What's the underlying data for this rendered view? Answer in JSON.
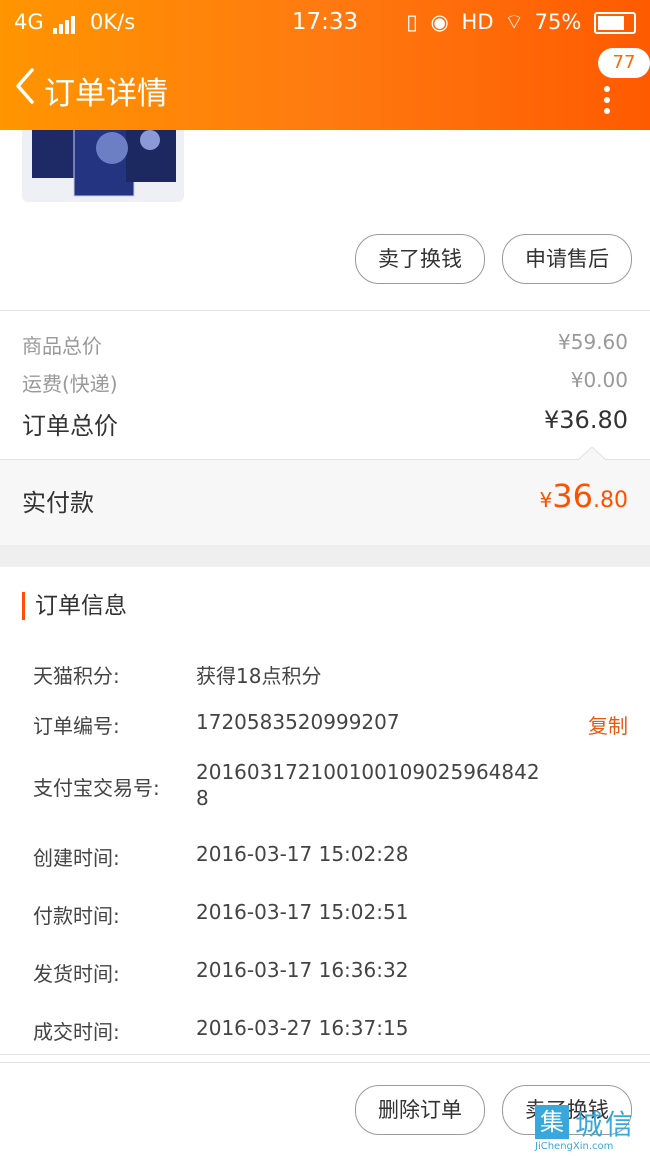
{
  "statusbar": {
    "network": "4G",
    "speed": "0K/s",
    "time": "17:33",
    "hd": "HD",
    "battery": "75%"
  },
  "header": {
    "title": "订单详情",
    "badge": "77"
  },
  "product_actions": {
    "sell_label": "卖了换钱",
    "after_sale_label": "申请售后"
  },
  "price": {
    "goods_total_label": "商品总价",
    "goods_total_value": "¥59.60",
    "shipping_label": "运费(快递)",
    "shipping_value": "¥0.00",
    "order_total_label": "订单总价",
    "order_total_value": "¥36.80",
    "paid_label": "实付款",
    "paid_currency": "¥",
    "paid_int": "36",
    "paid_dec": ".80"
  },
  "order_info": {
    "title": "订单信息",
    "points_label": "天猫积分:",
    "points_value": "获得18点积分",
    "order_no_label": "订单编号:",
    "order_no_value": "1720583520999207",
    "copy_label": "复制",
    "alipay_label": "支付宝交易号:",
    "alipay_line1": "201603172100100109025964842",
    "alipay_line2": "8",
    "created_label": "创建时间:",
    "created_value": "2016-03-17 15:02:28",
    "paid_time_label": "付款时间:",
    "paid_time_value": "2016-03-17 15:02:51",
    "shipped_label": "发货时间:",
    "shipped_value": "2016-03-17 16:36:32",
    "done_label": "成交时间:",
    "done_value": "2016-03-27 16:37:15"
  },
  "footer": {
    "delete_label": "删除订单",
    "sell_label": "卖了换钱"
  },
  "watermark": {
    "text_cn": "城信",
    "text_en": "JiChengXin.com"
  },
  "colors": {
    "accent": "#ff5000",
    "header_start": "#ff9500",
    "header_end": "#ff5a00",
    "copy": "#e85a0c"
  }
}
